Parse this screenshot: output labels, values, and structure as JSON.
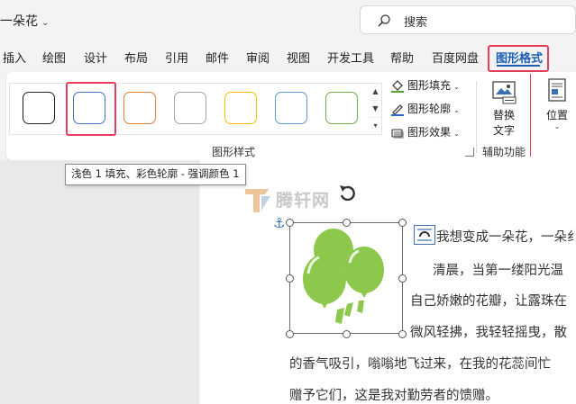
{
  "window": {
    "doc_title": "一朵花",
    "search_placeholder": "搜索"
  },
  "tabs": [
    {
      "label": "插入"
    },
    {
      "label": "绘图"
    },
    {
      "label": "设计"
    },
    {
      "label": "布局"
    },
    {
      "label": "引用"
    },
    {
      "label": "邮件"
    },
    {
      "label": "审阅"
    },
    {
      "label": "视图"
    },
    {
      "label": "开发工具"
    },
    {
      "label": "帮助"
    },
    {
      "label": "百度网盘"
    },
    {
      "label": "图形格式",
      "active": true
    }
  ],
  "ribbon": {
    "shape_styles_group": "图形样式",
    "swatch_outline_colors": [
      "#222222",
      "#4472c4",
      "#ed7d31",
      "#a5a5a5",
      "#ffc000",
      "#5b9bd5",
      "#70ad47"
    ],
    "fill": "图形填充",
    "outline": "图形轮廓",
    "effects": "图形效果",
    "alt_text_line1": "替换",
    "alt_text_line2": "文字",
    "accessibility_group": "辅助功能",
    "position": "位置"
  },
  "tooltip": "浅色 1 填充、彩色轮廓 - 强调颜色 1",
  "watermark": {
    "name": "腾轩网"
  },
  "document": {
    "shape_fill_color": "#8cc84b",
    "lines": [
      "我想变成一朵花，一朵纟",
      "清晨，当第一缕阳光温",
      "自己娇嫩的花瓣，让露珠在",
      "微风轻拂，我轻轻摇曳，散",
      "的香气吸引，嗡嗡地飞过来，在我的花蕊间忙",
      "赠予它们，这是我对勤劳者的馈赠。"
    ]
  }
}
